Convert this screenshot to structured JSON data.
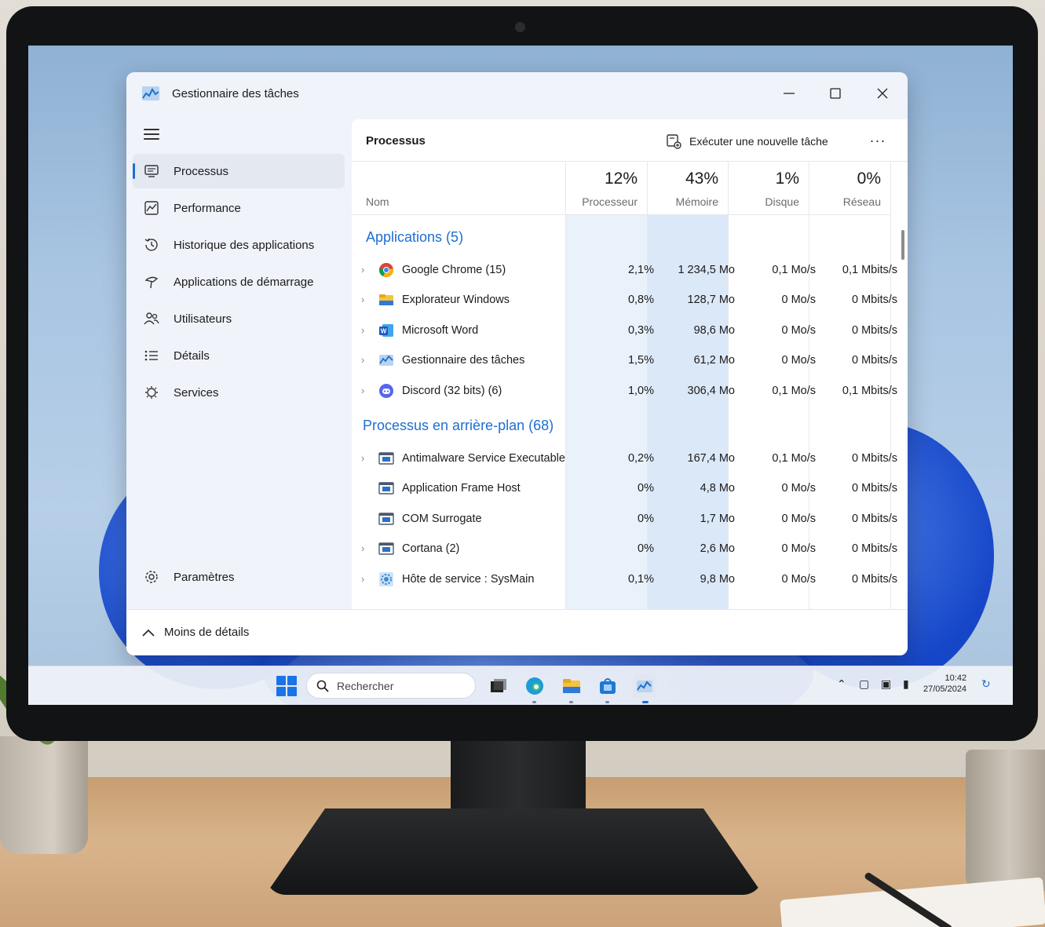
{
  "window": {
    "title": "Gestionnaire des tâches"
  },
  "sidebar": {
    "items": [
      {
        "label": "Processus",
        "icon": "processes-icon",
        "active": true
      },
      {
        "label": "Performance",
        "icon": "performance-icon"
      },
      {
        "label": "Historique des applications",
        "icon": "history-icon"
      },
      {
        "label": "Applications de démarrage",
        "icon": "startup-icon"
      },
      {
        "label": "Utilisateurs",
        "icon": "users-icon"
      },
      {
        "label": "Détails",
        "icon": "details-list-icon"
      },
      {
        "label": "Services",
        "icon": "services-icon"
      }
    ],
    "settings_label": "Paramètres"
  },
  "toolbar": {
    "title": "Processus",
    "run_task_label": "Exécuter une nouvelle tâche",
    "more_label": "···"
  },
  "columns": {
    "name_label": "Nom",
    "cpu": {
      "pct": "12%",
      "label": "Processeur"
    },
    "memory": {
      "pct": "43%",
      "label": "Mémoire"
    },
    "disk": {
      "pct": "1%",
      "label": "Disque"
    },
    "network": {
      "pct": "0%",
      "label": "Réseau"
    }
  },
  "groups": {
    "apps_label": "Applications (5)",
    "background_label": "Processus en arrière-plan (68)"
  },
  "apps": [
    {
      "name": "Google Chrome (15)",
      "cpu": "2,1%",
      "mem": "1 234,5 Mo",
      "disk": "0,1 Mo/s",
      "net": "0,1 Mbits/s",
      "icon": "chrome-icon",
      "expandable": true
    },
    {
      "name": "Explorateur Windows",
      "cpu": "0,8%",
      "mem": "128,7 Mo",
      "disk": "0 Mo/s",
      "net": "0 Mbits/s",
      "icon": "folder-icon",
      "expandable": true
    },
    {
      "name": "Microsoft Word",
      "cpu": "0,3%",
      "mem": "98,6 Mo",
      "disk": "0 Mo/s",
      "net": "0 Mbits/s",
      "icon": "word-icon",
      "expandable": true
    },
    {
      "name": "Gestionnaire des tâches",
      "cpu": "1,5%",
      "mem": "61,2 Mo",
      "disk": "0 Mo/s",
      "net": "0 Mbits/s",
      "icon": "task-manager-icon",
      "expandable": true
    },
    {
      "name": "Discord (32 bits) (6)",
      "cpu": "1,0%",
      "mem": "306,4 Mo",
      "disk": "0,1 Mo/s",
      "net": "0,1 Mbits/s",
      "icon": "discord-icon",
      "expandable": true
    }
  ],
  "background": [
    {
      "name": "Antimalware Service Executable",
      "cpu": "0,2%",
      "mem": "167,4 Mo",
      "disk": "0,1 Mo/s",
      "net": "0 Mbits/s",
      "icon": "service-window-icon",
      "expandable": true
    },
    {
      "name": "Application Frame Host",
      "cpu": "0%",
      "mem": "4,8 Mo",
      "disk": "0 Mo/s",
      "net": "0 Mbits/s",
      "icon": "service-window-icon",
      "expandable": false
    },
    {
      "name": "COM Surrogate",
      "cpu": "0%",
      "mem": "1,7 Mo",
      "disk": "0 Mo/s",
      "net": "0 Mbits/s",
      "icon": "service-window-icon",
      "expandable": false
    },
    {
      "name": "Cortana (2)",
      "cpu": "0%",
      "mem": "2,6 Mo",
      "disk": "0 Mo/s",
      "net": "0 Mbits/s",
      "icon": "service-window-icon",
      "expandable": true
    },
    {
      "name": "Hôte de service : SysMain",
      "cpu": "0,1%",
      "mem": "9,8 Mo",
      "disk": "0 Mo/s",
      "net": "0 Mbits/s",
      "icon": "gear-service-icon",
      "expandable": true
    }
  ],
  "footer": {
    "less_details_label": "Moins de détails"
  },
  "taskbar": {
    "search_placeholder": "Rechercher",
    "time": "10:42",
    "date": "27/05/2024"
  },
  "colors": {
    "accent": "#1e6fd0",
    "cpu_highlight": "#e9f1fb",
    "mem_highlight": "#dbe8f8"
  }
}
